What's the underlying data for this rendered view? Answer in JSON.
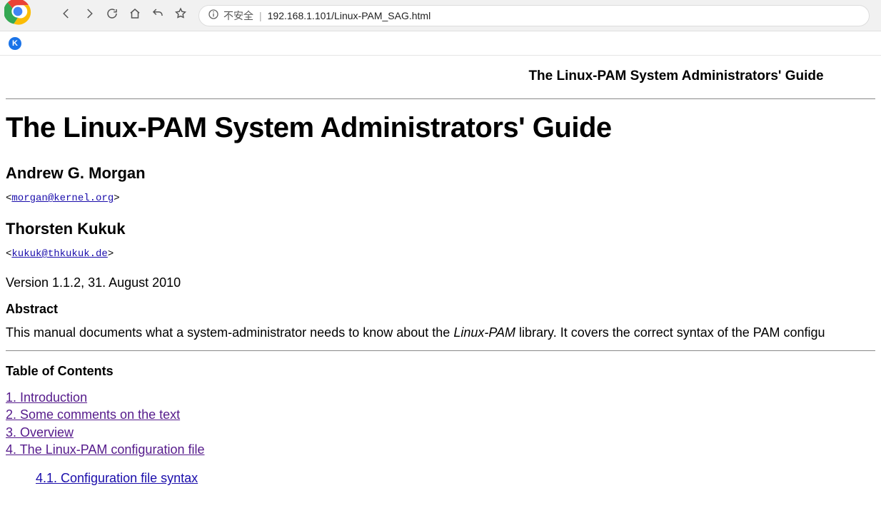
{
  "browser": {
    "insecure_label": "不安全",
    "url": "192.168.1.101/Linux-PAM_SAG.html"
  },
  "page": {
    "header_title": "The Linux-PAM System Administrators' Guide",
    "title": "The Linux-PAM System Administrators' Guide",
    "author1": "Andrew G. Morgan",
    "email1": "morgan@kernel.org",
    "author2": "Thorsten Kukuk",
    "email2": "kukuk@thkukuk.de",
    "version_line": "Version 1.1.2, 31. August 2010",
    "abstract_label": "Abstract",
    "abstract_pre": "This manual documents what a system-administrator needs to know about the ",
    "abstract_em": "Linux-PAM",
    "abstract_post": " library. It covers the correct syntax of the PAM configu",
    "toc_label": "Table of Contents",
    "toc": {
      "i1": "1. Introduction",
      "i2": "2. Some comments on the text",
      "i3": "3. Overview",
      "i4": "4. The Linux-PAM configuration file",
      "i4_1": "4.1. Configuration file syntax"
    }
  }
}
